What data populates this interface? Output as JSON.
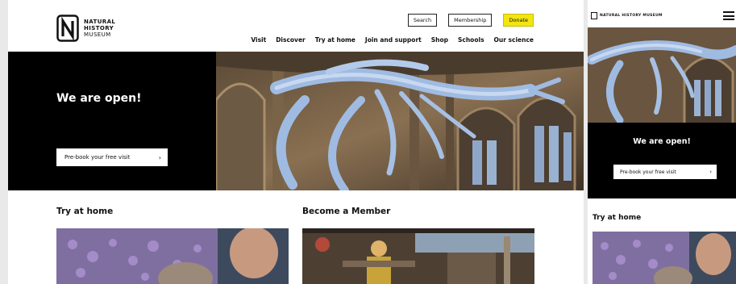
{
  "header": {
    "logo_lines": [
      "NATURAL",
      "HISTORY",
      "MUSEUM"
    ],
    "utility_buttons": [
      "Search",
      "Membership",
      "Donate"
    ],
    "nav": [
      "Visit",
      "Discover",
      "Try at home",
      "Join and support",
      "Shop",
      "Schools",
      "Our science"
    ]
  },
  "hero": {
    "title": "We are open!",
    "cta_label": "Pre-book your free visit",
    "cta_icon": "chevron-right-icon"
  },
  "sections": {
    "try_at_home": "Try at home",
    "become_member": "Become a Member"
  },
  "mobile": {
    "logo_text": "NATURAL HISTORY MUSEUM",
    "menu_icon": "hamburger-menu-icon",
    "hero_title": "We are open!",
    "cta_label": "Pre-book your free visit",
    "section_title": "Try at home"
  },
  "colors": {
    "donate": "#f2e511",
    "hero_black": "#000000",
    "skeleton_blue": "#8fb0dc"
  }
}
